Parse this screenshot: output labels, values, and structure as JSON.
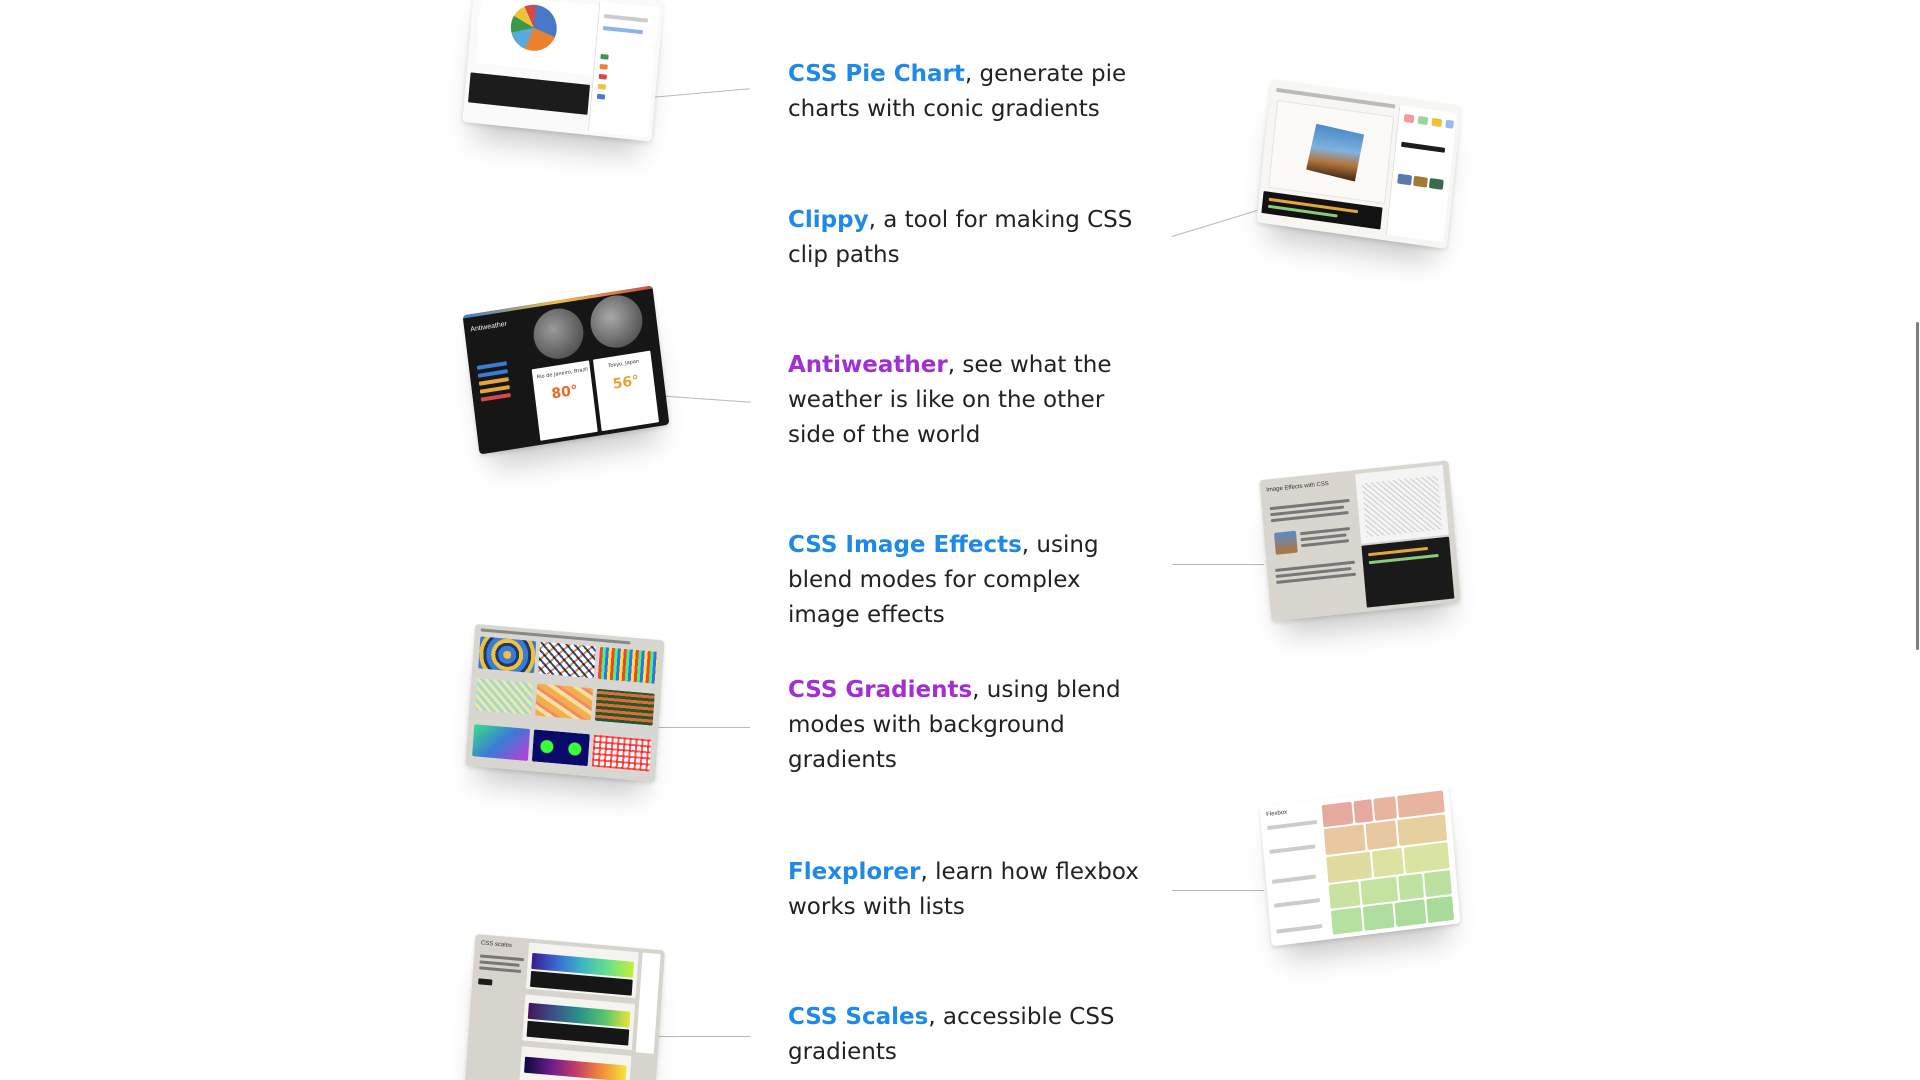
{
  "projects": [
    {
      "name": "CSS Pie Chart",
      "rest": ", generate pie charts with conic gradients",
      "link_color": "#1e8ae6"
    },
    {
      "name": "Clippy",
      "rest": ", a tool for making CSS clip paths",
      "link_color": "#1e8ae6"
    },
    {
      "name": "Antiweather",
      "rest": ", see what the weather is like on the other side of the world",
      "link_color": "#a12fd6"
    },
    {
      "name": "CSS Image Effects",
      "rest": ", using blend modes for complex image effects",
      "link_color": "#1e8ae6"
    },
    {
      "name": "CSS Gradients",
      "rest": ", using blend modes with background gradients",
      "link_color": "#a12fd6"
    },
    {
      "name": "Flexplorer",
      "rest": ", learn how flexbox works with lists",
      "link_color": "#1e8ae6"
    },
    {
      "name": "CSS Scales",
      "rest": ", accessible CSS gradients",
      "link_color": "#1e8ae6"
    }
  ],
  "thumbs": {
    "antiweather": {
      "title": "Antiweather",
      "city1": "Rio de Janeiro, Brazil",
      "temp1": "80°",
      "city2": "Tokyo, Japan",
      "temp2": "56°"
    },
    "image_effects": {
      "title": "Image Effects with CSS"
    },
    "flexplorer": {
      "title": "Flexbox"
    },
    "css_scales": {
      "title": "CSS scales"
    }
  },
  "colors": {
    "link_blue": "#1e8ae6",
    "link_purple": "#a12fd6",
    "text": "#222222",
    "connector": "#b8b8b8"
  }
}
